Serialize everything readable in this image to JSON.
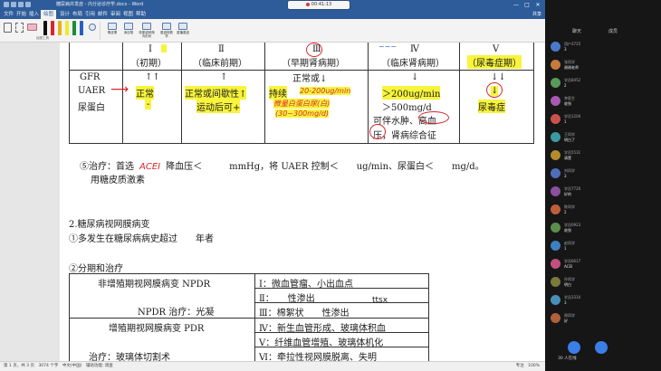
{
  "window": {
    "doc_title": "糖尿病并发症 - 内分泌诊疗学.docx - Word",
    "recorder": "00:41:13",
    "controls": [
      "—",
      "□",
      "✕"
    ]
  },
  "menubar": {
    "tabs": [
      "文件",
      "开始",
      "插入",
      "绘图",
      "设计",
      "布局",
      "引用",
      "邮件",
      "审阅",
      "视图",
      "帮助"
    ],
    "active_index": 3,
    "share": "共享"
  },
  "ribbon": {
    "group_label": "绘图工具",
    "buttons": [
      "橡皮擦",
      "添加笔",
      "将墨迹转换为形状",
      "墨迹转数学",
      "重播墨迹"
    ],
    "pen_colors": [
      "#111111",
      "#d8262a",
      "#e2b21c",
      "#f1ea2a",
      "#1d8c3a",
      "#2a5fc2"
    ]
  },
  "doc": {
    "stages": [
      "Ⅰ",
      "Ⅱ",
      "Ⅲ",
      "Ⅳ",
      "Ⅴ"
    ],
    "stage_names": [
      "（初期）",
      "（临床前期）",
      "（早期肾病期）",
      "（临床肾病期）",
      "（尿毒症期）"
    ],
    "row_gfr": "GFR",
    "row_uaer": "UAER",
    "row_protein": "尿蛋白",
    "gfr_cells": [
      "↑↑",
      "↑",
      "正常或↓",
      "↓",
      "↓↓"
    ],
    "uaer_cells": [
      "正常",
      "正常或间歇性↑",
      "持续",
      "20-200ug/min",
      "＞200ug/min",
      "↓"
    ],
    "protein_cells": [
      "-",
      "运动后可+",
      "＞500mg/d",
      "可伴水肿、高血",
      "压，肾病综合征",
      "尿毒症"
    ],
    "protein_note_1": "微量白蛋白尿(白)",
    "protein_note_2": "(30~300mg/d)",
    "treatment_1": "⑤治疗：首选",
    "treatment_hw": "ACEI",
    "treatment_2": "降血压＜　　　mmHg，将 UAER 控制＜　　ug/min、尿蛋白＜　　mg/d。",
    "treatment_3": "用糖皮质激素",
    "sec2_title": "2.糖尿病视网膜病变",
    "sec2_item1": "①多发生在糖尿病病史超过　　年者",
    "sec2_item2": "②分期和治疗",
    "npdr_title": "非增殖期视网膜病变 NPDR",
    "npdr_treat": "NPDR 治疗：光凝",
    "pdr_title": "增殖期视网膜病变 PDR",
    "pdr_treat": "治疗：玻璃体切割术",
    "grades": [
      "Ⅰ：微血管瘤、小出血点",
      "Ⅱ：　　性渗出",
      "Ⅲ：棉絮状　　性渗出",
      "Ⅳ：新生血管形成、玻璃体积血",
      "Ⅴ：纤维血管增殖、玻璃体机化",
      "Ⅵ：牵拉性视网膜脱离、失明"
    ],
    "ttsx": "ttsx"
  },
  "statusbar": {
    "left": "第 1 页，共 3 页　3074 个字　中文(中国)　辅助功能: 调查",
    "right": "专注　100%"
  },
  "panel": {
    "tabs": [
      "聊天",
      "成员"
    ],
    "messages": [
      {
        "name": "用户3725",
        "text": "3",
        "color": "#4a79c9"
      },
      {
        "name": "张同学",
        "text": "谢谢老师",
        "color": "#c77a3b"
      },
      {
        "name": "学员8452",
        "text": "2",
        "color": "#5a9a57"
      },
      {
        "name": "李医生",
        "text": "收到",
        "color": "#a45bb1"
      },
      {
        "name": "学员1204",
        "text": "1",
        "color": "#c9534a"
      },
      {
        "name": "王同学",
        "text": "明白了",
        "color": "#3a9aa4"
      },
      {
        "name": "学员5531",
        "text": "清楚",
        "color": "#b48b2c"
      },
      {
        "name": "刘同学",
        "text": "3",
        "color": "#4e6fb8"
      },
      {
        "name": "学员7720",
        "text": "好的",
        "color": "#8a4fa0"
      },
      {
        "name": "陈同学",
        "text": "2",
        "color": "#bd5f3c"
      },
      {
        "name": "学员0923",
        "text": "收到",
        "color": "#5b8e4a"
      },
      {
        "name": "赵同学",
        "text": "1",
        "color": "#3f7fbf"
      },
      {
        "name": "学员6617",
        "text": "ACEI",
        "color": "#c05080"
      },
      {
        "name": "孙同学",
        "text": "明白",
        "color": "#7a7a3a"
      },
      {
        "name": "学员3310",
        "text": "3",
        "color": "#4a8fb5"
      },
      {
        "name": "周同学",
        "text": "好",
        "color": "#b0603a"
      }
    ],
    "online": "30 人在线"
  }
}
